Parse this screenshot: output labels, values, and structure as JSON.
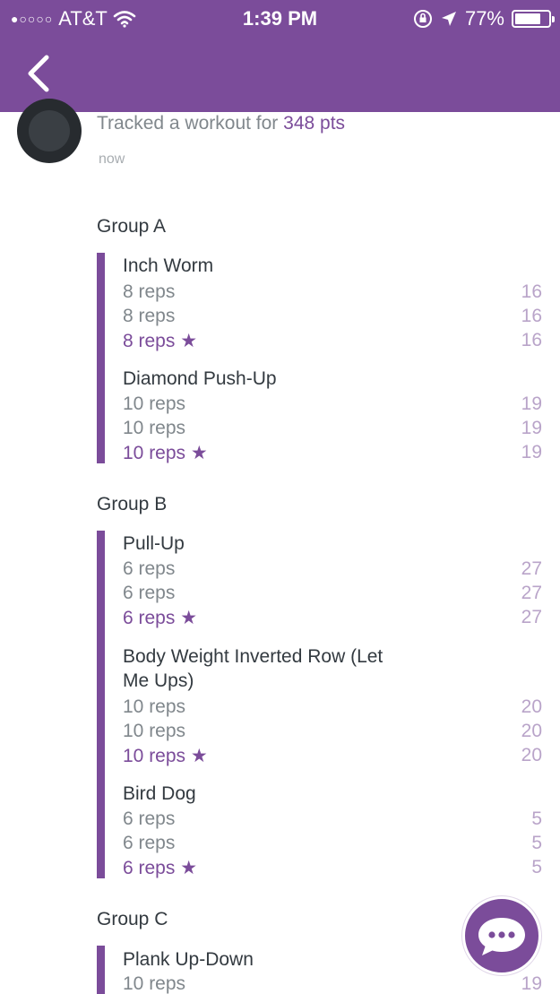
{
  "status_bar": {
    "carrier": "AT&T",
    "signal": "●○○○○",
    "time": "1:39 PM",
    "battery": "77%",
    "battery_level": 0.77
  },
  "activity": {
    "text": "Tracked a workout for ",
    "points": "348 pts",
    "time_ago": "now"
  },
  "groups": [
    {
      "title": "Group A"
    },
    {
      "title": "Group B"
    },
    {
      "title": "Group C"
    }
  ],
  "exercises": [
    {
      "name": "Inch Worm",
      "sets": [
        {
          "reps": "8 reps",
          "value": "16"
        },
        {
          "reps": "8 reps",
          "value": "16"
        },
        {
          "reps": "8 reps ★",
          "value": "16"
        }
      ]
    },
    {
      "name": "Diamond Push-Up",
      "sets": [
        {
          "reps": "10 reps",
          "value": "19"
        },
        {
          "reps": "10 reps",
          "value": "19"
        },
        {
          "reps": "10 reps ★",
          "value": "19"
        }
      ]
    },
    {
      "name": "Pull-Up",
      "sets": [
        {
          "reps": "6 reps",
          "value": "27"
        },
        {
          "reps": "6 reps",
          "value": "27"
        },
        {
          "reps": "6 reps ★",
          "value": "27"
        }
      ]
    },
    {
      "name_line1": "Body Weight Inverted Row (Let",
      "name_line2": "Me Ups)",
      "sets": [
        {
          "reps": "10 reps",
          "value": "20"
        },
        {
          "reps": "10 reps",
          "value": "20"
        },
        {
          "reps": "10 reps ★",
          "value": "20"
        }
      ]
    },
    {
      "name": "Bird Dog",
      "sets": [
        {
          "reps": "6 reps",
          "value": "5"
        },
        {
          "reps": "6 reps",
          "value": "5"
        },
        {
          "reps": "6 reps ★",
          "value": "5"
        }
      ]
    },
    {
      "name": "Plank Up-Down",
      "sets": [
        {
          "reps": "10 reps",
          "value": "19"
        }
      ]
    }
  ],
  "icons": {
    "back": "chevron-left-icon",
    "chat": "chat-bubble-icon",
    "wifi": "wifi-icon",
    "lock": "rotation-lock-icon",
    "location": "location-arrow-icon"
  },
  "colors": {
    "brand": "#7b4c9a",
    "text_dark": "#333a40",
    "text_muted": "#80878c",
    "value_light": "#b9a4c9"
  }
}
